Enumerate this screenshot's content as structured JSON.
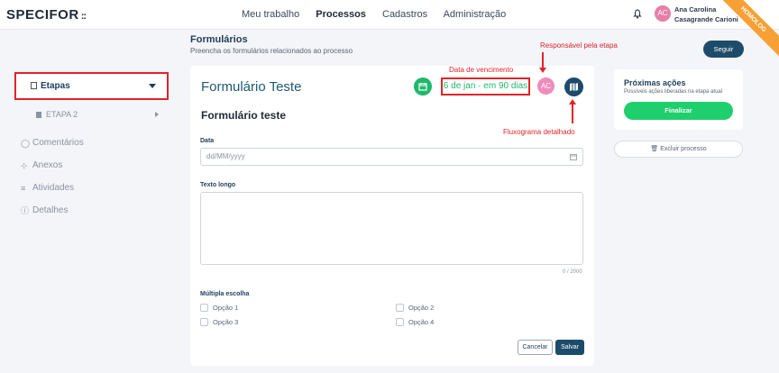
{
  "app": {
    "logo": "SPECIFOR",
    "logo_mark": "::",
    "nav": [
      "Meu trabalho",
      "Processos",
      "Cadastros",
      "Administração"
    ],
    "active_nav": "Processos",
    "user_initials": "AC",
    "user_name": "Ana Carolina Casagrande Carioni",
    "env_badge": "HOMOLOG"
  },
  "header": {
    "title": "Formulários",
    "subtitle": "Preencha os formulários relacionados ao processo",
    "follow_label": "Seguir"
  },
  "sidebar": {
    "section_label": "Etapas",
    "sub_item": "ETAPA 2",
    "items": [
      {
        "label": "Comentários",
        "icon": "comment-icon"
      },
      {
        "label": "Anexos",
        "icon": "paperclip-icon"
      },
      {
        "label": "Atividades",
        "icon": "list-icon"
      },
      {
        "label": "Detalhes",
        "icon": "info-icon"
      }
    ]
  },
  "form": {
    "title": "Formulário Teste",
    "due_date": "6 de jan · em 90 dias",
    "assignee_initials": "AC",
    "subtitle": "Formulário teste",
    "date_label": "Data",
    "date_placeholder": "dd/MM/yyyy",
    "long_text_label": "Texto longo",
    "char_counter": "0 / 2000",
    "multi_label": "Múltipla escolha",
    "options": [
      "Opção 1",
      "Opção 2",
      "Opção 3",
      "Opção 4"
    ],
    "cancel_label": "Cancelar",
    "save_label": "Salvar"
  },
  "next_actions": {
    "title": "Próximas ações",
    "subtitle": "Possíveis ações liberadas na etapa atual",
    "finalize_label": "Finalizar",
    "delete_label": "Excluir processo"
  },
  "annotations": {
    "responsible": "Responsável pela etapa",
    "due": "Data de vencimento",
    "flowchart": "Fluxograma detalhado"
  },
  "colors": {
    "primary": "#1d4c6a",
    "success": "#1fcf6e",
    "annotation": "#e0242a",
    "ribbon": "#f7a035"
  }
}
